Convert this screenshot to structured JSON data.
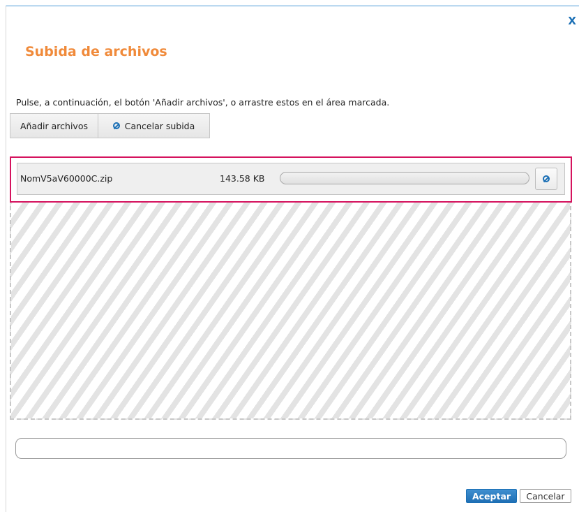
{
  "dialog": {
    "close_label": "X",
    "title": "Subida de archivos",
    "instructions": "Pulse, a continuación, el botón 'Añadir archivos', o arrastre estos en el área marcada."
  },
  "toolbar": {
    "add_label": "Añadir archivos",
    "cancel_label": "Cancelar subida",
    "cancel_icon": "ban-icon"
  },
  "files": [
    {
      "name": "NomV5aV60000C.zip",
      "size": "143.58 KB",
      "progress": 0,
      "cancel_icon": "ban-icon"
    }
  ],
  "colors": {
    "title": "#f08a3a",
    "accent": "#1a6fb5",
    "highlight_border": "#d5135e"
  },
  "footer": {
    "accept_label": "Aceptar",
    "cancel_label": "Cancelar"
  }
}
